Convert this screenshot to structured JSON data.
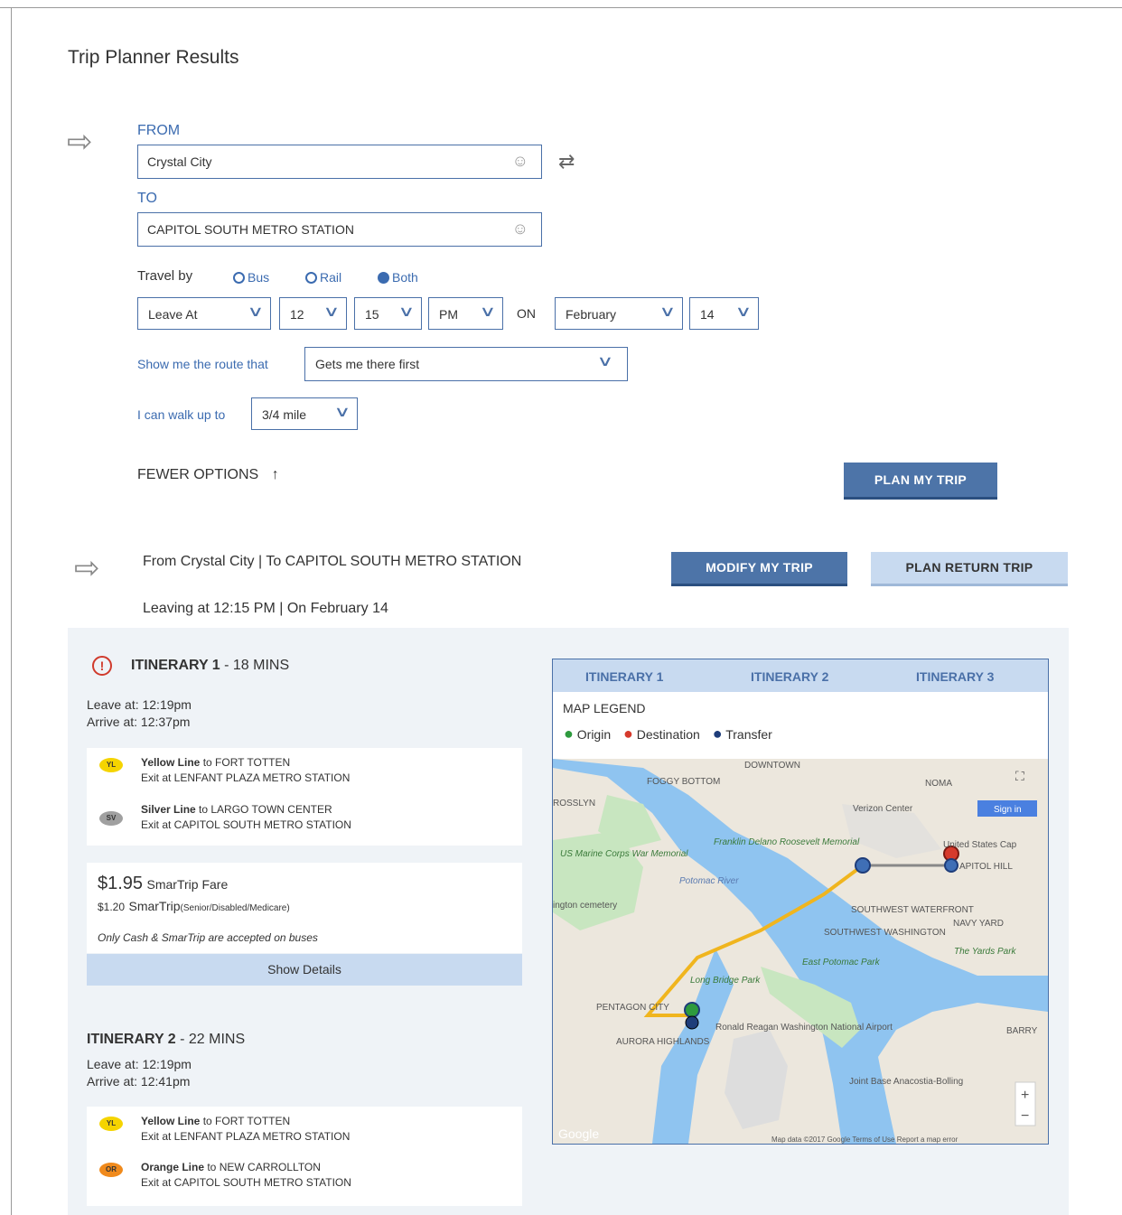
{
  "page": {
    "title": "Trip Planner Results"
  },
  "form": {
    "from_label": "FROM",
    "from_value": "Crystal City",
    "to_label": "TO",
    "to_value": "CAPITOL SOUTH METRO STATION",
    "travel_by_label": "Travel by",
    "travel_options": [
      {
        "label": "Bus",
        "selected": false
      },
      {
        "label": "Rail",
        "selected": false
      },
      {
        "label": "Both",
        "selected": true
      }
    ],
    "leave_at": "Leave At",
    "hour": "12",
    "minute": "15",
    "ampm": "PM",
    "on_label": "ON",
    "month": "February",
    "day": "14",
    "route_label": "Show me the route that",
    "route_value": "Gets me there first",
    "walk_label": "I can walk up to",
    "walk_value": "3/4 mile",
    "fewer_options": "FEWER OPTIONS",
    "plan_button": "PLAN MY TRIP"
  },
  "summary": {
    "line1": "From Crystal City  |  To CAPITOL SOUTH METRO STATION",
    "line2": "Leaving at 12:15 PM  |  On February 14",
    "modify_button": "MODIFY MY TRIP",
    "return_button": "PLAN RETURN TRIP"
  },
  "itineraries": [
    {
      "title": "ITINERARY 1",
      "duration": " - 18 MINS",
      "leave": "Leave at: 12:19pm",
      "arrive": "Arrive at: 12:37pm",
      "legs": [
        {
          "badge": "YL",
          "line": "Yellow Line",
          "to": " to FORT TOTTEN",
          "exit": "Exit at LENFANT PLAZA METRO STATION",
          "color": "#f5d400"
        },
        {
          "badge": "SV",
          "line": "Silver Line",
          "to": " to LARGO TOWN CENTER",
          "exit": "Exit at CAPITOL SOUTH METRO STATION",
          "color": "#a0a0a0"
        }
      ],
      "fare_amount": "$1.95",
      "fare_label": "SmarTrip Fare",
      "fare_senior_amount": "$1.20",
      "fare_senior_label": "SmarTrip",
      "fare_senior_note": "(Senior/Disabled/Medicare)",
      "fare_note": "Only Cash & SmarTrip are accepted on buses",
      "details_button": "Show Details"
    },
    {
      "title": "ITINERARY 2",
      "duration": " - 22 MINS",
      "leave": "Leave at: 12:19pm",
      "arrive": "Arrive at: 12:41pm",
      "legs": [
        {
          "badge": "YL",
          "line": "Yellow Line",
          "to": " to FORT TOTTEN",
          "exit": "Exit at LENFANT PLAZA METRO STATION",
          "color": "#f5d400"
        },
        {
          "badge": "OR",
          "line": "Orange Line",
          "to": " to NEW CARROLLTON",
          "exit": "Exit at CAPITOL SOUTH METRO STATION",
          "color": "#f08a1c"
        }
      ]
    }
  ],
  "map": {
    "tabs": [
      "ITINERARY 1",
      "ITINERARY 2",
      "ITINERARY 3"
    ],
    "legend_title": "MAP LEGEND",
    "legend": [
      "Origin",
      "Destination",
      "Transfer"
    ],
    "labels": {
      "downtown": "DOWNTOWN",
      "foggy": "FOGGY BOTTOM",
      "rosslyn": "ROSSLYN",
      "noma": "NOMA",
      "verizon": "Verizon Center",
      "signin": "Sign in",
      "us_capitol": "United States Cap",
      "capitol_hill": "APITOL HILL",
      "marine": "US Marine Corps War Memorial",
      "franklin": "Franklin Delano Roosevelt Memorial",
      "potomac": "Potomac River",
      "arlington": "ington cemetery",
      "sw_waterfront": "SOUTHWEST WATERFRONT",
      "sw_washington": "SOUTHWEST WASHINGTON",
      "navy_yard": "NAVY YARD",
      "yards_park": "The Yards Park",
      "east_potomac": "East Potomac Park",
      "long_bridge": "Long Bridge Park",
      "pentagon": "PENTAGON CITY",
      "reagan": "Ronald Reagan Washington National Airport",
      "aurora": "AURORA HIGHLANDS",
      "barry": "BARRY",
      "joint_base": "Joint Base Anacostia-Bolling",
      "footer": "Map data ©2017 Google   Terms of Use   Report a map error",
      "google": "Google"
    }
  }
}
